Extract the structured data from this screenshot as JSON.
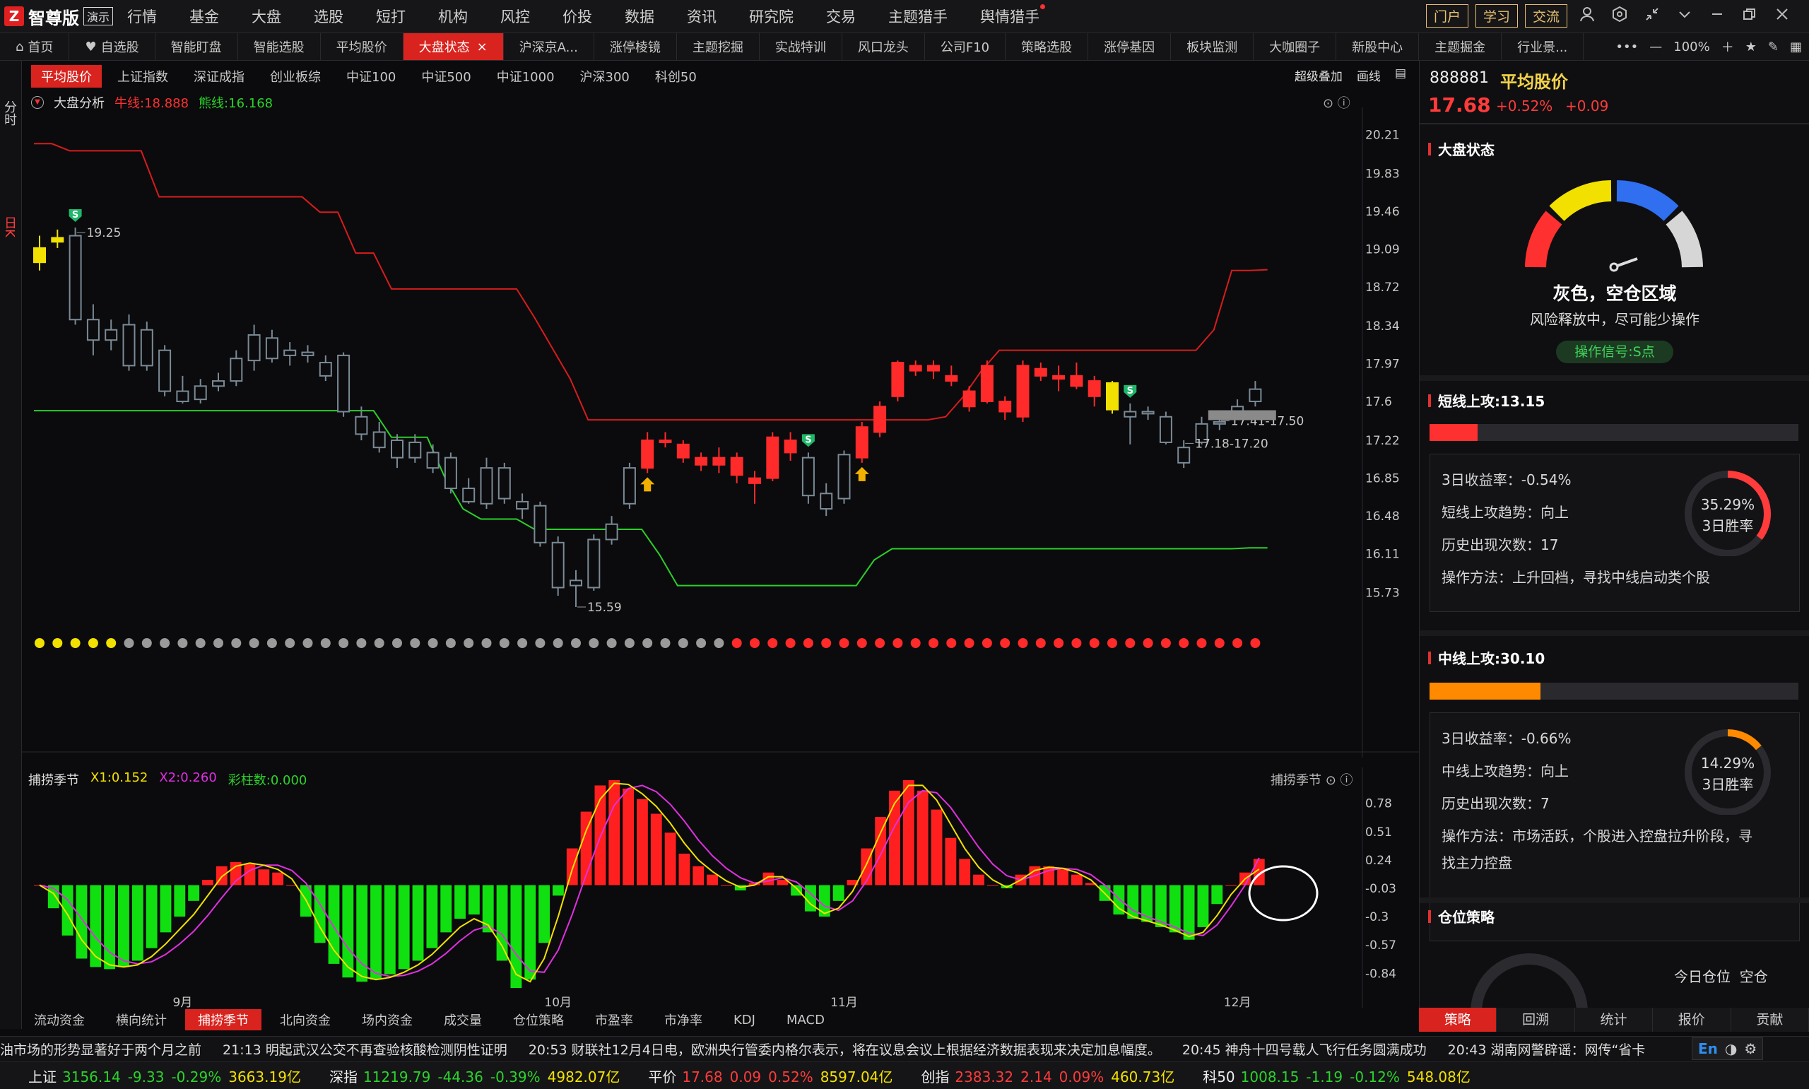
{
  "app": {
    "brand": "智尊版",
    "demo": "演示",
    "logo_char": "Z"
  },
  "menu": [
    "行情",
    "基金",
    "大盘",
    "选股",
    "短打",
    "机构",
    "风控",
    "价投",
    "数据",
    "资讯",
    "研究院",
    "交易",
    "主题猎手",
    "舆情猎手"
  ],
  "top_buttons": [
    "门户",
    "学习",
    "交流"
  ],
  "tabs": [
    "首页",
    "自选股",
    "智能盯盘",
    "智能选股",
    "平均股价",
    "大盘状态",
    "沪深京A...",
    "涨停棱镜",
    "主题挖掘",
    "实战特训",
    "风口龙头",
    "公司F10",
    "策略选股",
    "涨停基因",
    "板块监测",
    "大咖圈子",
    "新股中心",
    "主题掘金",
    "行业景..."
  ],
  "active_tab": "大盘状态",
  "zoom": "100%",
  "left_strip": {
    "fenshi": "分时",
    "rik": "日K"
  },
  "index_chips": [
    "平均股价",
    "上证指数",
    "深证成指",
    "创业板综",
    "中证100",
    "中证500",
    "中证1000",
    "沪深300",
    "科创50"
  ],
  "chart_opts": {
    "overlay": "超级叠加",
    "draw": "画线"
  },
  "indicator": {
    "name": "大盘分析",
    "bull": "牛线:18.888",
    "bear": "熊线:16.168"
  },
  "sub_indicator": {
    "name": "捕捞季节",
    "x1": "X1:0.152",
    "x2": "X2:0.260",
    "bars": "彩柱数:0.000",
    "right_name": "捕捞季节"
  },
  "colors": {
    "up": "#ff2a2a",
    "down": "#2bd32b",
    "yellow": "#f2e100",
    "accent": "#d8231e",
    "gauge_gray": "#d6d6d6",
    "gauge_blue": "#2f6ff0"
  },
  "chart_data": {
    "type": "candlestick",
    "ylim": [
      15.5,
      20.35
    ],
    "yticks": [
      20.21,
      19.83,
      19.46,
      19.09,
      18.72,
      18.34,
      17.97,
      17.6,
      17.22,
      16.85,
      16.48,
      16.11,
      15.73
    ],
    "x_months": [
      {
        "label": "9月",
        "i": 8
      },
      {
        "label": "10月",
        "i": 29
      },
      {
        "label": "11月",
        "i": 45
      },
      {
        "label": "12月",
        "i": 67
      }
    ],
    "annotations": [
      {
        "text": "19.25",
        "i": 2,
        "v": 19.25
      },
      {
        "text": "15.59",
        "i": 30,
        "v": 15.59
      },
      {
        "text": "17.41-17.50",
        "i": 66,
        "v": 17.41
      },
      {
        "text": "17.18-17.20",
        "i": 64,
        "v": 17.19
      }
    ],
    "candles": [
      {
        "o": 19.1,
        "c": 18.96,
        "h": 19.22,
        "l": 18.88,
        "k": "y"
      },
      {
        "o": 19.16,
        "c": 19.2,
        "h": 19.28,
        "l": 19.1,
        "k": "y"
      },
      {
        "o": 19.22,
        "c": 18.4,
        "h": 19.3,
        "l": 18.35,
        "k": "d"
      },
      {
        "o": 18.4,
        "c": 18.2,
        "h": 18.55,
        "l": 18.05,
        "k": "d"
      },
      {
        "o": 18.2,
        "c": 18.3,
        "h": 18.4,
        "l": 18.1,
        "k": "d"
      },
      {
        "o": 18.35,
        "c": 17.95,
        "h": 18.45,
        "l": 17.9,
        "k": "d"
      },
      {
        "o": 17.95,
        "c": 18.3,
        "h": 18.38,
        "l": 17.9,
        "k": "d"
      },
      {
        "o": 18.1,
        "c": 17.7,
        "h": 18.15,
        "l": 17.65,
        "k": "d"
      },
      {
        "o": 17.7,
        "c": 17.6,
        "h": 17.85,
        "l": 17.58,
        "k": "d"
      },
      {
        "o": 17.62,
        "c": 17.75,
        "h": 17.82,
        "l": 17.58,
        "k": "d"
      },
      {
        "o": 17.75,
        "c": 17.8,
        "h": 17.88,
        "l": 17.7,
        "k": "d"
      },
      {
        "o": 17.8,
        "c": 18.02,
        "h": 18.1,
        "l": 17.75,
        "k": "d"
      },
      {
        "o": 18.0,
        "c": 18.25,
        "h": 18.35,
        "l": 17.9,
        "k": "d"
      },
      {
        "o": 18.22,
        "c": 18.02,
        "h": 18.3,
        "l": 17.98,
        "k": "d"
      },
      {
        "o": 18.05,
        "c": 18.1,
        "h": 18.18,
        "l": 17.95,
        "k": "d"
      },
      {
        "o": 18.08,
        "c": 18.05,
        "h": 18.15,
        "l": 17.98,
        "k": "d"
      },
      {
        "o": 17.98,
        "c": 17.85,
        "h": 18.05,
        "l": 17.8,
        "k": "d"
      },
      {
        "o": 18.05,
        "c": 17.5,
        "h": 18.08,
        "l": 17.45,
        "k": "d"
      },
      {
        "o": 17.45,
        "c": 17.28,
        "h": 17.55,
        "l": 17.22,
        "k": "d"
      },
      {
        "o": 17.3,
        "c": 17.15,
        "h": 17.4,
        "l": 17.1,
        "k": "d"
      },
      {
        "o": 17.05,
        "c": 17.22,
        "h": 17.28,
        "l": 16.95,
        "k": "d"
      },
      {
        "o": 17.2,
        "c": 17.05,
        "h": 17.28,
        "l": 17.0,
        "k": "d"
      },
      {
        "o": 17.1,
        "c": 16.95,
        "h": 17.18,
        "l": 16.9,
        "k": "d"
      },
      {
        "o": 17.05,
        "c": 16.75,
        "h": 17.1,
        "l": 16.7,
        "k": "d"
      },
      {
        "o": 16.75,
        "c": 16.62,
        "h": 16.85,
        "l": 16.6,
        "k": "d"
      },
      {
        "o": 16.6,
        "c": 16.95,
        "h": 17.05,
        "l": 16.55,
        "k": "d"
      },
      {
        "o": 16.95,
        "c": 16.65,
        "h": 17.0,
        "l": 16.6,
        "k": "d"
      },
      {
        "o": 16.62,
        "c": 16.55,
        "h": 16.7,
        "l": 16.45,
        "k": "d"
      },
      {
        "o": 16.58,
        "c": 16.22,
        "h": 16.62,
        "l": 16.18,
        "k": "d"
      },
      {
        "o": 16.22,
        "c": 15.78,
        "h": 16.28,
        "l": 15.7,
        "k": "d"
      },
      {
        "o": 15.8,
        "c": 15.85,
        "h": 15.95,
        "l": 15.59,
        "k": "d"
      },
      {
        "o": 15.78,
        "c": 16.25,
        "h": 16.3,
        "l": 15.75,
        "k": "d"
      },
      {
        "o": 16.25,
        "c": 16.4,
        "h": 16.48,
        "l": 16.2,
        "k": "d"
      },
      {
        "o": 16.6,
        "c": 16.95,
        "h": 17.0,
        "l": 16.55,
        "k": "d"
      },
      {
        "o": 16.95,
        "c": 17.22,
        "h": 17.3,
        "l": 16.9,
        "k": "u"
      },
      {
        "o": 17.2,
        "c": 17.22,
        "h": 17.3,
        "l": 17.15,
        "k": "u"
      },
      {
        "o": 17.18,
        "c": 17.05,
        "h": 17.22,
        "l": 17.0,
        "k": "u"
      },
      {
        "o": 17.05,
        "c": 16.98,
        "h": 17.1,
        "l": 16.92,
        "k": "u"
      },
      {
        "o": 16.98,
        "c": 17.05,
        "h": 17.15,
        "l": 16.9,
        "k": "u"
      },
      {
        "o": 17.05,
        "c": 16.88,
        "h": 17.1,
        "l": 16.8,
        "k": "u"
      },
      {
        "o": 16.85,
        "c": 16.8,
        "h": 16.92,
        "l": 16.6,
        "k": "u"
      },
      {
        "o": 16.85,
        "c": 17.25,
        "h": 17.3,
        "l": 16.82,
        "k": "u"
      },
      {
        "o": 17.1,
        "c": 17.22,
        "h": 17.3,
        "l": 17.02,
        "k": "u"
      },
      {
        "o": 17.05,
        "c": 16.68,
        "h": 17.1,
        "l": 16.6,
        "k": "d"
      },
      {
        "o": 16.7,
        "c": 16.55,
        "h": 16.8,
        "l": 16.48,
        "k": "d"
      },
      {
        "o": 16.65,
        "c": 17.08,
        "h": 17.12,
        "l": 16.6,
        "k": "d"
      },
      {
        "o": 17.05,
        "c": 17.35,
        "h": 17.4,
        "l": 17.0,
        "k": "u"
      },
      {
        "o": 17.3,
        "c": 17.55,
        "h": 17.6,
        "l": 17.25,
        "k": "u"
      },
      {
        "o": 17.65,
        "c": 17.98,
        "h": 18.0,
        "l": 17.6,
        "k": "u"
      },
      {
        "o": 17.95,
        "c": 17.9,
        "h": 18.0,
        "l": 17.85,
        "k": "u"
      },
      {
        "o": 17.9,
        "c": 17.95,
        "h": 18.0,
        "l": 17.82,
        "k": "u"
      },
      {
        "o": 17.8,
        "c": 17.85,
        "h": 17.95,
        "l": 17.75,
        "k": "u"
      },
      {
        "o": 17.7,
        "c": 17.55,
        "h": 17.75,
        "l": 17.5,
        "k": "u"
      },
      {
        "o": 17.6,
        "c": 17.95,
        "h": 18.0,
        "l": 17.58,
        "k": "u"
      },
      {
        "o": 17.6,
        "c": 17.5,
        "h": 17.65,
        "l": 17.42,
        "k": "u"
      },
      {
        "o": 17.45,
        "c": 17.95,
        "h": 18.0,
        "l": 17.4,
        "k": "u"
      },
      {
        "o": 17.92,
        "c": 17.85,
        "h": 17.98,
        "l": 17.8,
        "k": "u"
      },
      {
        "o": 17.85,
        "c": 17.82,
        "h": 17.95,
        "l": 17.7,
        "k": "u"
      },
      {
        "o": 17.85,
        "c": 17.75,
        "h": 17.98,
        "l": 17.72,
        "k": "u"
      },
      {
        "o": 17.8,
        "c": 17.65,
        "h": 17.85,
        "l": 17.55,
        "k": "u"
      },
      {
        "o": 17.78,
        "c": 17.52,
        "h": 17.8,
        "l": 17.48,
        "k": "y"
      },
      {
        "o": 17.5,
        "c": 17.45,
        "h": 17.58,
        "l": 17.18,
        "k": "d"
      },
      {
        "o": 17.48,
        "c": 17.5,
        "h": 17.55,
        "l": 17.42,
        "k": "d"
      },
      {
        "o": 17.45,
        "c": 17.2,
        "h": 17.5,
        "l": 17.18,
        "k": "d"
      },
      {
        "o": 17.0,
        "c": 17.15,
        "h": 17.22,
        "l": 16.95,
        "k": "d"
      },
      {
        "o": 17.2,
        "c": 17.38,
        "h": 17.45,
        "l": 17.18,
        "k": "d"
      },
      {
        "o": 17.38,
        "c": 17.4,
        "h": 17.45,
        "l": 17.32,
        "k": "d"
      },
      {
        "o": 17.48,
        "c": 17.55,
        "h": 17.62,
        "l": 17.45,
        "k": "d"
      },
      {
        "o": 17.6,
        "c": 17.72,
        "h": 17.8,
        "l": 17.55,
        "k": "d"
      }
    ],
    "bull_line": [
      20.12,
      20.12,
      20.05,
      20.05,
      20.05,
      20.05,
      20.05,
      19.6,
      19.6,
      19.6,
      19.6,
      19.6,
      19.6,
      19.6,
      19.6,
      19.6,
      19.45,
      19.45,
      19.05,
      19.05,
      18.7,
      18.7,
      18.7,
      18.7,
      18.7,
      18.7,
      18.7,
      18.7,
      18.42,
      18.12,
      17.82,
      17.42,
      17.42,
      17.42,
      17.42,
      17.42,
      17.42,
      17.42,
      17.42,
      17.42,
      17.42,
      17.42,
      17.42,
      17.42,
      17.42,
      17.42,
      17.42,
      17.42,
      17.42,
      17.42,
      17.42,
      17.45,
      17.65,
      17.9,
      18.1,
      18.1,
      18.1,
      18.1,
      18.1,
      18.1,
      18.1,
      18.1,
      18.1,
      18.1,
      18.1,
      18.1,
      18.3,
      18.88,
      18.88,
      18.888
    ],
    "bear_line": [
      17.51,
      17.51,
      17.51,
      17.51,
      17.51,
      17.51,
      17.51,
      17.51,
      17.51,
      17.51,
      17.51,
      17.51,
      17.51,
      17.51,
      17.51,
      17.51,
      17.51,
      17.51,
      17.51,
      17.51,
      17.25,
      17.25,
      17.25,
      16.85,
      16.55,
      16.45,
      16.45,
      16.45,
      16.35,
      16.35,
      16.35,
      16.35,
      16.35,
      16.35,
      16.35,
      16.1,
      15.8,
      15.8,
      15.8,
      15.8,
      15.8,
      15.8,
      15.8,
      15.8,
      15.8,
      15.8,
      15.8,
      16.05,
      16.16,
      16.16,
      16.16,
      16.16,
      16.16,
      16.16,
      16.16,
      16.16,
      16.16,
      16.16,
      16.16,
      16.16,
      16.16,
      16.16,
      16.16,
      16.16,
      16.16,
      16.16,
      16.16,
      16.16,
      16.168,
      16.168
    ],
    "signals": [
      {
        "i": 2,
        "t": "S"
      },
      {
        "i": 43,
        "t": "S"
      },
      {
        "i": 61,
        "t": "S"
      },
      {
        "i": 34,
        "t": "B"
      },
      {
        "i": 46,
        "t": "B"
      }
    ],
    "dots": "yyyyyggggggggggggggggggggggggggggggggggrrrrrrrrrrrrrrrrrrrrrrrrrrrrrrrrrrrrrrrrrrrrrrrrrrrggggggggggggggrrrrrrrrrrgyggggggggg",
    "sub": {
      "ylim": [
        -1.02,
        1.0
      ],
      "yticks": [
        0.78,
        0.51,
        0.24,
        -0.03,
        -0.3,
        -0.57,
        -0.84
      ],
      "bars": [
        0.0,
        -0.22,
        -0.48,
        -0.7,
        -0.78,
        -0.8,
        -0.78,
        -0.72,
        -0.6,
        -0.45,
        -0.3,
        -0.15,
        0.05,
        0.18,
        0.22,
        0.2,
        0.15,
        0.12,
        0.0,
        -0.3,
        -0.55,
        -0.75,
        -0.88,
        -0.92,
        -0.9,
        -0.85,
        -0.8,
        -0.72,
        -0.6,
        -0.45,
        -0.32,
        -0.28,
        -0.45,
        -0.72,
        -0.98,
        -0.9,
        -0.55,
        -0.1,
        0.35,
        0.7,
        0.95,
        1.0,
        0.92,
        0.82,
        0.68,
        0.5,
        0.3,
        0.18,
        0.1,
        0.0,
        -0.05,
        0.02,
        0.12,
        0.05,
        -0.1,
        -0.25,
        -0.3,
        -0.15,
        0.05,
        0.35,
        0.65,
        0.9,
        1.0,
        0.9,
        0.72,
        0.45,
        0.25,
        0.1,
        0.0,
        -0.03,
        0.1,
        0.18,
        0.18,
        0.15,
        0.1,
        0.02,
        -0.15,
        -0.28,
        -0.32,
        -0.35,
        -0.4,
        -0.45,
        -0.52,
        -0.4,
        -0.18,
        0.0,
        0.12,
        0.25
      ],
      "x1": [
        0.0,
        -0.08,
        -0.28,
        -0.52,
        -0.68,
        -0.76,
        -0.78,
        -0.76,
        -0.68,
        -0.56,
        -0.42,
        -0.28,
        -0.1,
        0.08,
        0.18,
        0.21,
        0.19,
        0.15,
        0.06,
        -0.14,
        -0.4,
        -0.62,
        -0.78,
        -0.87,
        -0.9,
        -0.88,
        -0.83,
        -0.76,
        -0.66,
        -0.53,
        -0.4,
        -0.32,
        -0.38,
        -0.58,
        -0.85,
        -0.92,
        -0.7,
        -0.3,
        0.15,
        0.52,
        0.82,
        0.97,
        0.96,
        0.87,
        0.75,
        0.59,
        0.4,
        0.24,
        0.13,
        0.04,
        -0.02,
        0.0,
        0.08,
        0.08,
        -0.03,
        -0.18,
        -0.27,
        -0.22,
        -0.06,
        0.2,
        0.5,
        0.78,
        0.95,
        0.95,
        0.81,
        0.58,
        0.35,
        0.17,
        0.05,
        -0.02,
        0.05,
        0.14,
        0.17,
        0.16,
        0.12,
        0.05,
        -0.08,
        -0.22,
        -0.3,
        -0.34,
        -0.38,
        -0.43,
        -0.49,
        -0.45,
        -0.29,
        -0.09,
        0.06,
        0.152
      ],
      "x2": [
        0.0,
        -0.03,
        -0.14,
        -0.32,
        -0.5,
        -0.64,
        -0.72,
        -0.75,
        -0.73,
        -0.66,
        -0.56,
        -0.44,
        -0.29,
        -0.12,
        0.04,
        0.14,
        0.19,
        0.19,
        0.14,
        0.02,
        -0.18,
        -0.4,
        -0.6,
        -0.75,
        -0.84,
        -0.87,
        -0.86,
        -0.82,
        -0.75,
        -0.65,
        -0.53,
        -0.43,
        -0.39,
        -0.47,
        -0.66,
        -0.82,
        -0.83,
        -0.62,
        -0.28,
        0.1,
        0.46,
        0.76,
        0.92,
        0.95,
        0.89,
        0.77,
        0.61,
        0.43,
        0.28,
        0.16,
        0.07,
        0.02,
        0.04,
        0.07,
        0.03,
        -0.08,
        -0.2,
        -0.24,
        -0.15,
        0.04,
        0.29,
        0.56,
        0.79,
        0.9,
        0.88,
        0.74,
        0.55,
        0.36,
        0.2,
        0.09,
        0.05,
        0.09,
        0.14,
        0.16,
        0.15,
        0.1,
        0.0,
        -0.13,
        -0.24,
        -0.3,
        -0.35,
        -0.4,
        -0.46,
        -0.48,
        -0.38,
        -0.2,
        0.0,
        0.26
      ]
    }
  },
  "bottom_tabs": [
    "流动资金",
    "横向统计",
    "捕捞季节",
    "北向资金",
    "场内资金",
    "成交量",
    "仓位策略",
    "市盈率",
    "市净率",
    "KDJ",
    "MACD"
  ],
  "active_bottom": "捕捞季节",
  "right": {
    "code": "888881",
    "name": "平均股价",
    "price": "17.68",
    "pct": "+0.52%",
    "chg": "+0.09",
    "state_title": "大盘状态",
    "gauge_label": "灰色，空仓区域",
    "gauge_sub": "风险释放中，尽可能少操作",
    "op_signal": "操作信号:S点",
    "short": {
      "title": "短线上攻:13.15",
      "fill": 0.13,
      "color": "#ff3030",
      "l1": "3日收益率：-0.54%",
      "l2": "短线上攻趋势：向上",
      "l3": "历史出现次数：17",
      "l4": "操作方法：上升回档，寻找中线启动类个股",
      "ring_pct": "35.29%",
      "ring_lbl": "3日胜率",
      "ring_val": 0.3529,
      "ring_color": "#ff3b3b"
    },
    "mid": {
      "title": "中线上攻:30.10",
      "fill": 0.3,
      "color": "#ff8a00",
      "l1": "3日收益率：-0.66%",
      "l2": "中线上攻趋势：向上",
      "l3": "历史出现次数：7",
      "l4": "操作方法：市场活跃，个股进入控盘拉升阶段，寻",
      "l5": "找主力控盘",
      "ring_pct": "14.29%",
      "ring_lbl": "3日胜率",
      "ring_val": 0.1429,
      "ring_color": "#ff8a00"
    },
    "pos": {
      "title": "仓位策略",
      "today": "今日仓位",
      "val": "空仓"
    },
    "tabs": [
      "策略",
      "回溯",
      "统计",
      "报价",
      "贡献"
    ],
    "active_tab": "策略"
  },
  "news": [
    "油市场的形势显著好于两个月之前",
    "21:13 明起武汉公交不再查验核酸检测阴性证明",
    "20:53 财联社12月4日电，欧洲央行管委内格尔表示，将在议息会议上根据经济数据表现来决定加息幅度。",
    "20:45 神舟十四号载人飞行任务圆满成功",
    "20:43 湖南网警辟谣：网传“省卡"
  ],
  "status": [
    {
      "name": "上证",
      "v": "3156.14",
      "c": "-9.33",
      "p": "-0.29%",
      "a": "3663.19亿",
      "dir": "dn"
    },
    {
      "name": "深指",
      "v": "11219.79",
      "c": "-44.36",
      "p": "-0.39%",
      "a": "4982.07亿",
      "dir": "dn"
    },
    {
      "name": "平价",
      "v": "17.68",
      "c": "0.09",
      "p": "0.52%",
      "a": "8597.04亿",
      "dir": "up"
    },
    {
      "name": "创指",
      "v": "2383.32",
      "c": "2.14",
      "p": "0.09%",
      "a": "460.73亿",
      "dir": "up"
    },
    {
      "name": "科50",
      "v": "1008.15",
      "c": "-1.19",
      "p": "-0.12%",
      "a": "548.08亿",
      "dir": "dn"
    }
  ],
  "ime": "En"
}
